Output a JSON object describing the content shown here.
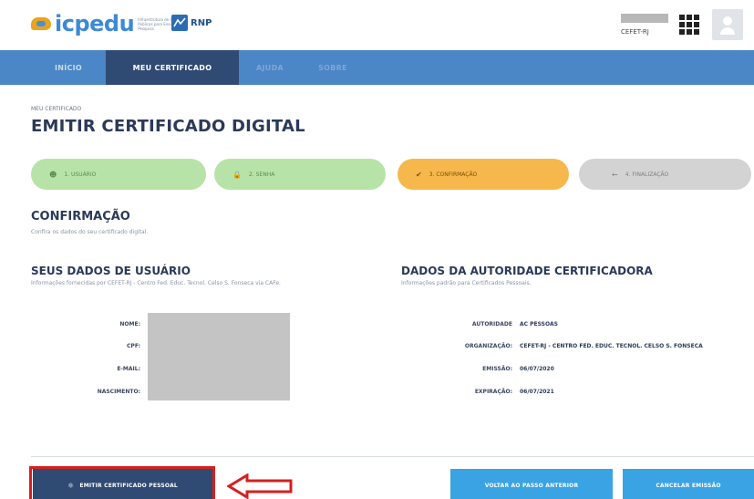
{
  "header": {
    "brand": "icpedu",
    "brand_sub": "Infraestrutura de Chaves Públicas para Ensino e Pesquisa",
    "partner": "RNP",
    "user_org": "CEFET-RJ"
  },
  "nav": {
    "items": [
      {
        "label": "INÍCIO"
      },
      {
        "label": "MEU CERTIFICADO"
      },
      {
        "label": "AJUDA"
      },
      {
        "label": "SOBRE"
      }
    ],
    "active_index": 1
  },
  "page": {
    "breadcrumb": "MEU CERTIFICADO",
    "title": "EMITIR CERTIFICADO DIGITAL"
  },
  "steps": [
    {
      "label": "1. USUÁRIO",
      "icon": "user-icon",
      "state": "done"
    },
    {
      "label": "2. SENHA",
      "icon": "lock-icon",
      "state": "done"
    },
    {
      "label": "3. CONFIRMAÇÃO",
      "icon": "check-circle-icon",
      "state": "current"
    },
    {
      "label": "4. FINALIZAÇÃO",
      "icon": "arrow-left-icon",
      "state": "todo"
    }
  ],
  "confirmation": {
    "title": "CONFIRMAÇÃO",
    "subtitle": "Confira os dados do seu certificado digital."
  },
  "user_data": {
    "title": "SEUS DADOS DE USUÁRIO",
    "subtitle": "Informações fornecidas por CEFET-RJ - Centro Fed. Educ. Tecnol. Celso S. Fonseca via CAFe.",
    "labels": {
      "name": "NOME:",
      "cpf": "CPF:",
      "email": "E-MAIL:",
      "birth": "NASCIMENTO:"
    }
  },
  "ca_data": {
    "title": "DADOS DA AUTORIDADE CERTIFICADORA",
    "subtitle": "Informações padrão para Certificados Pessoais.",
    "rows": [
      {
        "label": "AUTORIDADE",
        "value": "AC PESSOAS"
      },
      {
        "label": "ORGANIZAÇÃO:",
        "value": "CEFET-RJ - CENTRO FED. EDUC. TECNOL. CELSO S. FONSECA"
      },
      {
        "label": "EMISSÃO:",
        "value": "06/07/2020"
      },
      {
        "label": "EXPIRAÇÃO:",
        "value": "06/07/2021"
      }
    ]
  },
  "actions": {
    "issue": "EMITIR CERTIFICADO PESSOAL",
    "back": "VOLTAR AO PASSO ANTERIOR",
    "cancel": "CANCELAR EMISSÃO"
  },
  "colors": {
    "nav": "#4b86c6",
    "nav_active": "#2f4a73",
    "step_done": "#b7e3a8",
    "step_current": "#f6b84d",
    "step_todo": "#d3d3d3",
    "button_secondary": "#3aa3e3",
    "highlight": "#d42020"
  }
}
